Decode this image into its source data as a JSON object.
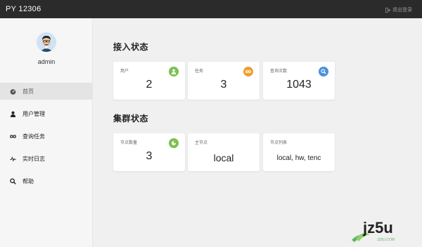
{
  "app": {
    "title": "PY 12306",
    "logout_label": "退出登录"
  },
  "sidebar": {
    "username": "admin",
    "items": [
      {
        "label": "首页",
        "icon": "dashboard-icon",
        "active": true
      },
      {
        "label": "用户管理",
        "icon": "user-icon",
        "active": false
      },
      {
        "label": "查询任务",
        "icon": "infinity-icon",
        "active": false
      },
      {
        "label": "实时日志",
        "icon": "pulse-icon",
        "active": false
      },
      {
        "label": "帮助",
        "icon": "search-icon",
        "active": false
      }
    ]
  },
  "access": {
    "title": "接入状态",
    "cards": [
      {
        "label": "用户",
        "value": "2",
        "badge_color": "#7cc04f",
        "icon": "user-icon"
      },
      {
        "label": "任务",
        "value": "3",
        "badge_color": "#f0a030",
        "icon": "infinity-icon"
      },
      {
        "label": "查询次数",
        "value": "1043",
        "badge_color": "#4a90d9",
        "icon": "search-icon"
      }
    ]
  },
  "cluster": {
    "title": "集群状态",
    "cards": [
      {
        "label": "节点数量",
        "value": "3",
        "badge_color": "#7cc04f",
        "icon": "pie-icon"
      },
      {
        "label": "主节点",
        "value": "local"
      },
      {
        "label": "节点列表",
        "value": "local, hw, tenc"
      }
    ]
  },
  "watermark": {
    "text": "jz5u",
    "sub": "JZ5U.COM"
  }
}
